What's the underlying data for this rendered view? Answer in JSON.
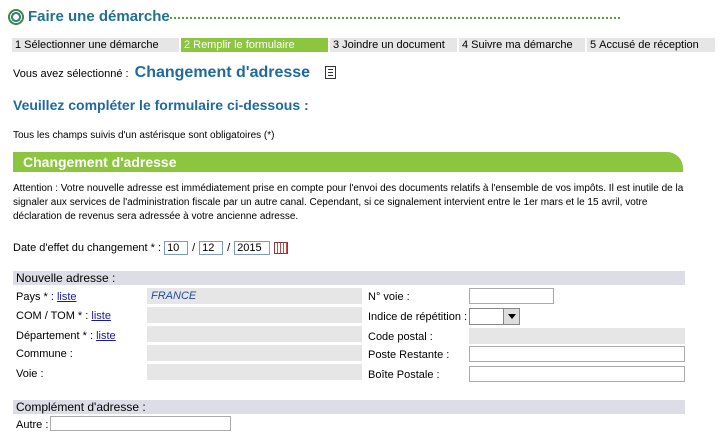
{
  "header": {
    "title": "Faire une démarche"
  },
  "steps": [
    {
      "num": "1",
      "label": "Sélectionner une démarche",
      "active": false
    },
    {
      "num": "2",
      "label": "Remplir le formulaire",
      "active": true
    },
    {
      "num": "3",
      "label": "Joindre un document",
      "active": false
    },
    {
      "num": "4",
      "label": "Suivre ma démarche",
      "active": false
    },
    {
      "num": "5",
      "label": "Accusé de réception",
      "active": false
    }
  ],
  "selection": {
    "prefix": "Vous avez sélectionné :",
    "value": "Changement d'adresse"
  },
  "instruction": "Veuillez compléter le formulaire ci-dessous  :",
  "required_note": "Tous les champs suivis d'un astérisque sont obligatoires (*)",
  "section": {
    "title": "Changement d'adresse",
    "attention": "Attention : Votre nouvelle adresse est immédiatement prise en compte pour l'envoi des documents relatifs à l'ensemble de vos impôts. Il est inutile de la signaler aux services de l'administration fiscale par un autre canal. Cependant, si ce signalement intervient entre le 1er mars et le 15 avril, votre déclaration de revenus sera adressée à votre ancienne adresse."
  },
  "date": {
    "label": "Date d'effet du changement * :",
    "day": "10",
    "month": "12",
    "year": "2015",
    "sep": "/"
  },
  "nouvelle_adresse": {
    "heading": "Nouvelle adresse :",
    "pays": {
      "label": "Pays * :",
      "link": "liste",
      "value": "FRANCE"
    },
    "com_tom": {
      "label": "COM / TOM * :",
      "link": "liste"
    },
    "departement": {
      "label": "Département * :",
      "link": "liste"
    },
    "commune": {
      "label": "Commune :"
    },
    "voie": {
      "label": "Voie :"
    },
    "no_voie": {
      "label": "N° voie :"
    },
    "indice": {
      "label": "Indice de répétition :"
    },
    "code_postal": {
      "label": "Code postal :"
    },
    "poste_restante": {
      "label": "Poste Restante :"
    },
    "boite_postale": {
      "label": "Boîte Postale :"
    }
  },
  "complement": {
    "heading": "Complément d'adresse :",
    "autre": {
      "label": "Autre :"
    }
  },
  "colors": {
    "accent_green": "#8cc63f",
    "title_blue": "#1e6a9e",
    "header_blue": "#22728f"
  },
  "icons": [
    "globe-logo-icon",
    "document-icon",
    "calendar-icon",
    "chevron-down-icon"
  ]
}
